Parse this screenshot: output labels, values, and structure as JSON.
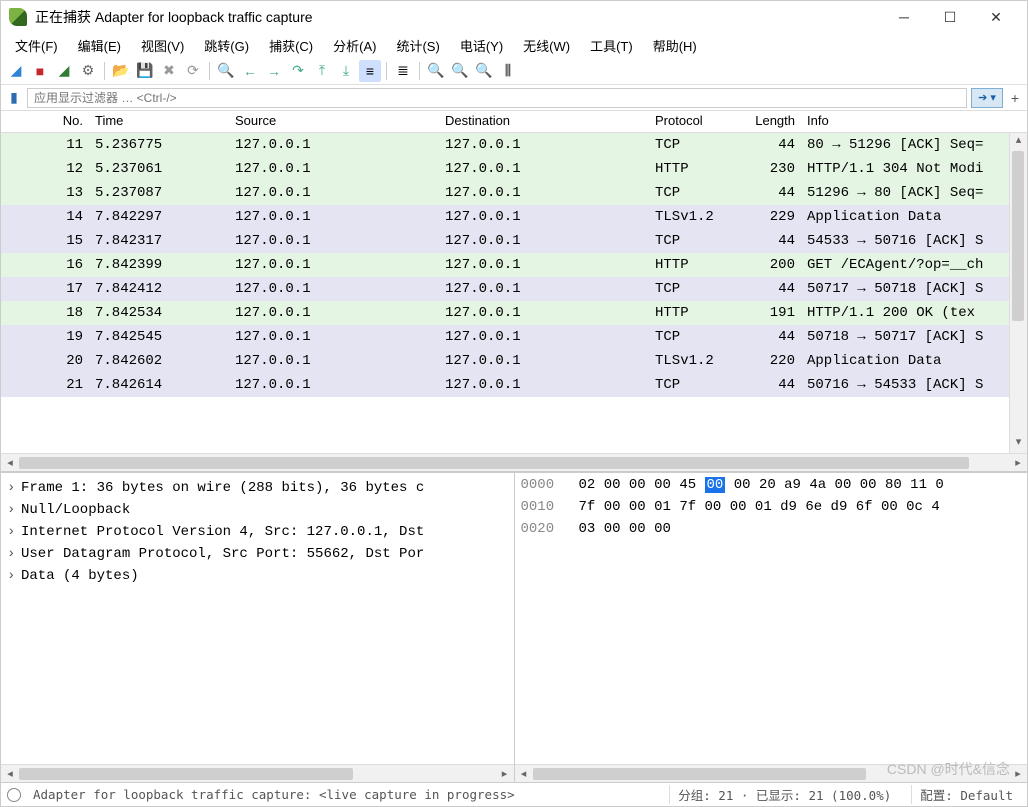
{
  "window": {
    "title": "正在捕获 Adapter for loopback traffic capture"
  },
  "menu": {
    "file": "文件(F)",
    "edit": "编辑(E)",
    "view": "视图(V)",
    "go": "跳转(G)",
    "capture": "捕获(C)",
    "analyze": "分析(A)",
    "statistics": "统计(S)",
    "telephony": "电话(Y)",
    "wireless": "无线(W)",
    "tools": "工具(T)",
    "help": "帮助(H)"
  },
  "filter": {
    "placeholder": "应用显示过滤器 … <Ctrl-/>",
    "plus": "+"
  },
  "columns": {
    "no": "No.",
    "time": "Time",
    "source": "Source",
    "destination": "Destination",
    "protocol": "Protocol",
    "length": "Length",
    "info": "Info"
  },
  "packets": [
    {
      "no": "11",
      "time": "5.236775",
      "src": "127.0.0.1",
      "dst": "127.0.0.1",
      "proto": "TCP",
      "len": "44",
      "info": "80 → 51296 [ACK] Seq=",
      "cls": "row-green"
    },
    {
      "no": "12",
      "time": "5.237061",
      "src": "127.0.0.1",
      "dst": "127.0.0.1",
      "proto": "HTTP",
      "len": "230",
      "info": "HTTP/1.1 304 Not Modi",
      "cls": "row-green"
    },
    {
      "no": "13",
      "time": "5.237087",
      "src": "127.0.0.1",
      "dst": "127.0.0.1",
      "proto": "TCP",
      "len": "44",
      "info": "51296 → 80 [ACK] Seq=",
      "cls": "row-green"
    },
    {
      "no": "14",
      "time": "7.842297",
      "src": "127.0.0.1",
      "dst": "127.0.0.1",
      "proto": "TLSv1.2",
      "len": "229",
      "info": "Application Data",
      "cls": "row-purple"
    },
    {
      "no": "15",
      "time": "7.842317",
      "src": "127.0.0.1",
      "dst": "127.0.0.1",
      "proto": "TCP",
      "len": "44",
      "info": "54533 → 50716 [ACK] S",
      "cls": "row-purple"
    },
    {
      "no": "16",
      "time": "7.842399",
      "src": "127.0.0.1",
      "dst": "127.0.0.1",
      "proto": "HTTP",
      "len": "200",
      "info": "GET /ECAgent/?op=__ch",
      "cls": "row-green"
    },
    {
      "no": "17",
      "time": "7.842412",
      "src": "127.0.0.1",
      "dst": "127.0.0.1",
      "proto": "TCP",
      "len": "44",
      "info": "50717 → 50718 [ACK] S",
      "cls": "row-purple"
    },
    {
      "no": "18",
      "time": "7.842534",
      "src": "127.0.0.1",
      "dst": "127.0.0.1",
      "proto": "HTTP",
      "len": "191",
      "info": "HTTP/1.1 200 OK  (tex",
      "cls": "row-green"
    },
    {
      "no": "19",
      "time": "7.842545",
      "src": "127.0.0.1",
      "dst": "127.0.0.1",
      "proto": "TCP",
      "len": "44",
      "info": "50718 → 50717 [ACK] S",
      "cls": "row-purple"
    },
    {
      "no": "20",
      "time": "7.842602",
      "src": "127.0.0.1",
      "dst": "127.0.0.1",
      "proto": "TLSv1.2",
      "len": "220",
      "info": "Application Data",
      "cls": "row-purple"
    },
    {
      "no": "21",
      "time": "7.842614",
      "src": "127.0.0.1",
      "dst": "127.0.0.1",
      "proto": "TCP",
      "len": "44",
      "info": "50716 → 54533 [ACK] S",
      "cls": "row-purple"
    }
  ],
  "tree": [
    "Frame 1: 36 bytes on wire (288 bits), 36 bytes c",
    "Null/Loopback",
    "Internet Protocol Version 4, Src: 127.0.0.1, Dst",
    "User Datagram Protocol, Src Port: 55662, Dst Por",
    "Data (4 bytes)"
  ],
  "hex": {
    "rows": [
      {
        "off": "0000",
        "bytes_a": "02 00 00 00 45 ",
        "sel": "00",
        "bytes_b": " 00 20  a9 4a 00 00 80 11 0"
      },
      {
        "off": "0010",
        "bytes_a": "7f 00 00 01 7f 00 00 01  d9 6e d9 6f 00 0c 4",
        "sel": "",
        "bytes_b": ""
      },
      {
        "off": "0020",
        "bytes_a": "03 00 00 00",
        "sel": "",
        "bytes_b": ""
      }
    ]
  },
  "status": {
    "main": "Adapter for loopback traffic capture: <live capture in progress>",
    "packets": "分组: 21  · 已显示: 21 (100.0%)",
    "profile": "配置: Default"
  },
  "watermark": "CSDN @时代&信念"
}
